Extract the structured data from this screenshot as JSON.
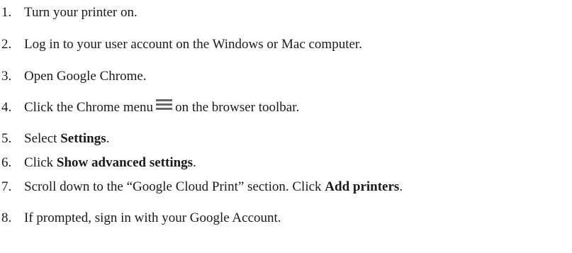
{
  "steps": [
    {
      "number": "1.",
      "text": "Turn your printer on."
    },
    {
      "number": "2.",
      "text": "Log in to your user account on the Windows or Mac computer."
    },
    {
      "number": "3.",
      "text": "Open Google Chrome."
    },
    {
      "number": "4.",
      "text_before": "Click the Chrome menu",
      "icon": "menu-icon",
      "text_after": "on the browser toolbar."
    },
    {
      "number": "5.",
      "text_before": "Select ",
      "bold": "Settings",
      "text_after": "."
    },
    {
      "number": "6.",
      "text_before": "Click ",
      "bold": "Show advanced settings",
      "text_after": "."
    },
    {
      "number": "7.",
      "text_before": "Scroll down to the “Google Cloud Print” section. Click ",
      "bold": "Add printers",
      "text_after": "."
    },
    {
      "number": "8.",
      "text": "If prompted, sign in with your Google Account."
    }
  ]
}
